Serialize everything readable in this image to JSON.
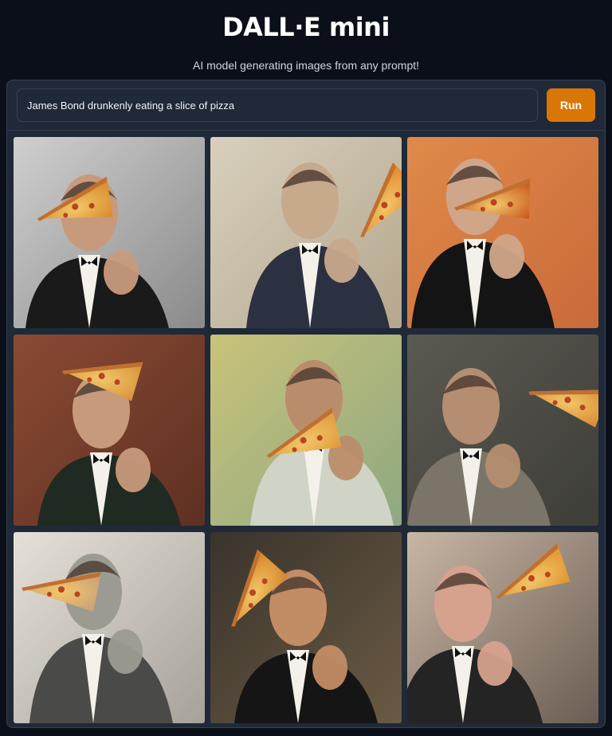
{
  "header": {
    "title": "DALL·E mini",
    "subtitle": "AI model generating images from any prompt!"
  },
  "prompt": {
    "value": "James Bond drunkenly eating a slice of pizza",
    "run_label": "Run"
  },
  "colors": {
    "background": "#0b0f19",
    "panel": "#1f2937",
    "accent": "#d97706"
  },
  "results": [
    {
      "bg": "#cfcfcf",
      "bg2": "#8a8a8a",
      "suit": "#1a1a1a",
      "skin": "#c79a7c",
      "pizza": "#d98a2b"
    },
    {
      "bg": "#d8d0bd",
      "bg2": "#b5a78d",
      "suit": "#2b3140",
      "skin": "#c7a98c",
      "pizza": "#e08a2c"
    },
    {
      "bg": "#e08a4a",
      "bg2": "#c96a3a",
      "suit": "#141414",
      "skin": "#d0a68a",
      "pizza": "#c85a1f"
    },
    {
      "bg": "#8a4a34",
      "bg2": "#5e3022",
      "suit": "#1f2a22",
      "skin": "#c79a7c",
      "pizza": "#d8943a"
    },
    {
      "bg": "#c9c37a",
      "bg2": "#8fa882",
      "suit": "#cfd4c6",
      "skin": "#b98d6c",
      "pizza": "#e09a3c"
    },
    {
      "bg": "#5a5a52",
      "bg2": "#3e3e38",
      "suit": "#7a7568",
      "skin": "#b58d70",
      "pizza": "#d88a32"
    },
    {
      "bg": "#e5e0d8",
      "bg2": "#a6a29a",
      "suit": "#4a4a48",
      "skin": "#9b9b92",
      "pizza": "#c9a07a"
    },
    {
      "bg": "#3a342c",
      "bg2": "#6a5a44",
      "suit": "#151515",
      "skin": "#c28c64",
      "pizza": "#d8852a"
    },
    {
      "bg": "#c8b6a4",
      "bg2": "#6b5d54",
      "suit": "#242424",
      "skin": "#d6a28e",
      "pizza": "#e0962f"
    }
  ]
}
